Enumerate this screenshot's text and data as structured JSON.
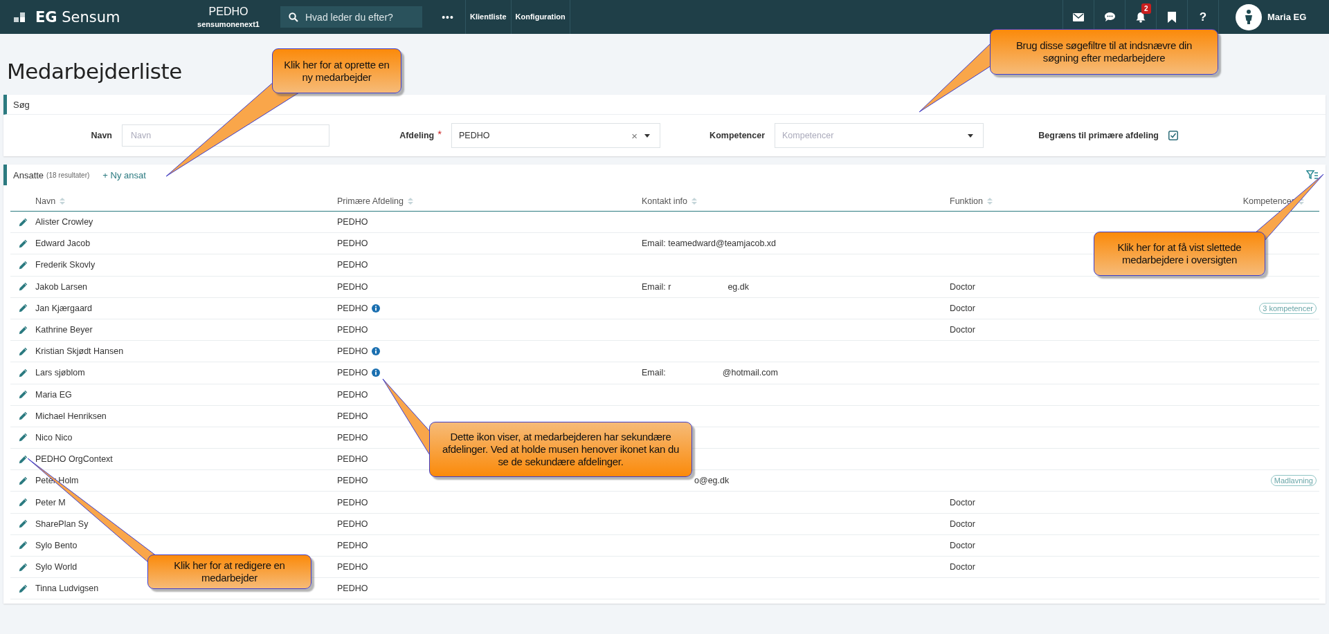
{
  "topbar": {
    "logo": "**EG** Sensum",
    "org": {
      "name": "PEDHO",
      "sub": "sensumonenext1"
    },
    "search": {
      "placeholder": "Hvad leder du efter?"
    },
    "more": "•••",
    "links": [
      "Klientliste",
      "Konfiguration"
    ],
    "notifications": "2",
    "help": "?",
    "user": "Maria EG"
  },
  "page_title": "Medarbejderliste",
  "search_panel": {
    "title": "Søg",
    "fields": [
      {
        "kind": "text",
        "label": "Navn",
        "placeholder": "Navn"
      },
      {
        "kind": "select",
        "label": "Afdeling",
        "required_mark": "*",
        "value": "PEDHO",
        "clear": "×"
      },
      {
        "kind": "select",
        "label": "Kompetencer",
        "placeholder": "Kompetencer"
      },
      {
        "kind": "checkbox",
        "label": "Begræns til primære afdeling",
        "checked": true
      }
    ]
  },
  "employees": {
    "title": "Ansatte",
    "count": "(18 resultater)",
    "add": "+ Ny ansat",
    "columns": [
      "Navn",
      "Primære Afdeling",
      "Kontakt info",
      "Funktion",
      "Kompetencer"
    ],
    "rows": [
      {
        "name": "Alister Crowley",
        "department": "PEDHO",
        "info": false
      },
      {
        "name": "Edward Jacob",
        "department": "PEDHO",
        "info": false,
        "contact": [
          {
            "kind": "text",
            "text": "Email: teamedward@teamjacob.xd"
          }
        ]
      },
      {
        "name": "Frederik Skovly",
        "department": "PEDHO",
        "info": false
      },
      {
        "name": "Jakob Larsen",
        "department": "PEDHO",
        "info": false,
        "contact": [
          {
            "kind": "text",
            "text": "Email: r"
          },
          {
            "kind": "redacted"
          },
          {
            "kind": "text",
            "text": "eg.dk"
          }
        ],
        "function": "Doctor"
      },
      {
        "name": "Jan Kjærgaard",
        "department": "PEDHO",
        "info": true,
        "function": "Doctor",
        "competence": "3 kompetencer"
      },
      {
        "name": "Kathrine Beyer",
        "department": "PEDHO",
        "info": false,
        "function": "Doctor"
      },
      {
        "name": "Kristian Skjødt Hansen",
        "department": "PEDHO",
        "info": true
      },
      {
        "name": "Lars sjøblom",
        "department": "PEDHO",
        "info": true,
        "contact": [
          {
            "kind": "text",
            "text": "Email:"
          },
          {
            "kind": "redacted"
          },
          {
            "kind": "text",
            "text": "@hotmail.com"
          }
        ]
      },
      {
        "name": "Maria EG",
        "department": "PEDHO",
        "info": false
      },
      {
        "name": "Michael Henriksen",
        "department": "PEDHO",
        "info": false
      },
      {
        "name": "Nico Nico",
        "department": "PEDHO",
        "info": false
      },
      {
        "name": "PEDHO OrgContext",
        "department": "PEDHO",
        "info": false
      },
      {
        "name": "Peter Holm",
        "department": "PEDHO",
        "info": false,
        "contact": [
          {
            "kind": "redacted"
          },
          {
            "kind": "text",
            "text": "o@eg.dk"
          }
        ],
        "competence": "Madlavning"
      },
      {
        "name": "Peter M",
        "department": "PEDHO",
        "info": false,
        "function": "Doctor"
      },
      {
        "name": "SharePlan Sy",
        "department": "PEDHO",
        "info": false,
        "function": "Doctor"
      },
      {
        "name": "Sylo Bento",
        "department": "PEDHO",
        "info": false,
        "function": "Doctor"
      },
      {
        "name": "Sylo World",
        "department": "PEDHO",
        "info": false,
        "function": "Doctor"
      },
      {
        "name": "Tinna Ludvigsen",
        "department": "PEDHO",
        "info": false
      }
    ]
  },
  "callouts": [
    {
      "text": "Klik her for at oprette en ny medarbejder"
    },
    {
      "text": "Brug disse søgefiltre til at indsnævre din søgning efter medarbejdere"
    },
    {
      "text": "Klik her for at få vist slettede medarbejdere i oversigten"
    },
    {
      "text": "Dette ikon viser, at medarbejderen har sekundære afdelinger. Ved at holde musen henover ikonet kan du se de sekundære afdelinger."
    },
    {
      "text": "Klik her for at redigere en medarbejder"
    }
  ]
}
